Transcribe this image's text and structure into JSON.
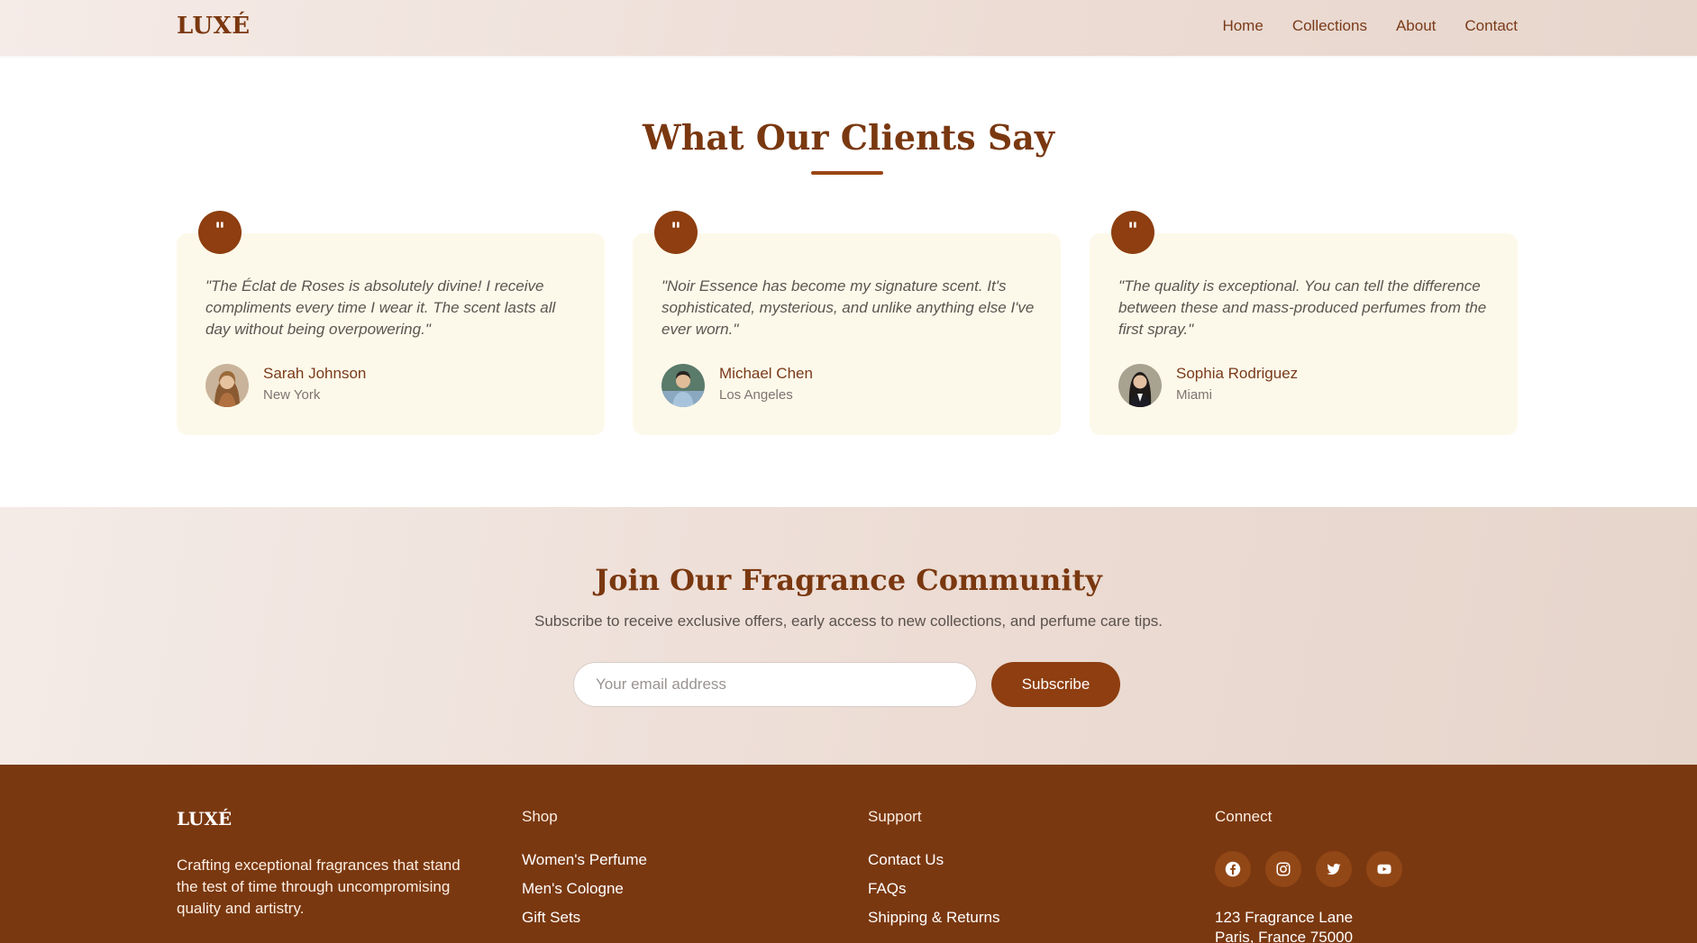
{
  "header": {
    "logo": "LUXÉ",
    "nav": [
      "Home",
      "Collections",
      "About",
      "Contact"
    ]
  },
  "testimonials": {
    "title": "What Our Clients Say",
    "quote_mark": "\"",
    "items": [
      {
        "text": "\"The Éclat de Roses is absolutely divine! I receive compliments every time I wear it. The scent lasts all day without being overpowering.\"",
        "name": "Sarah Johnson",
        "location": "New York"
      },
      {
        "text": "\"Noir Essence has become my signature scent. It's sophisticated, mysterious, and unlike anything else I've ever worn.\"",
        "name": "Michael Chen",
        "location": "Los Angeles"
      },
      {
        "text": "\"The quality is exceptional. You can tell the difference between these and mass-produced perfumes from the first spray.\"",
        "name": "Sophia Rodriguez",
        "location": "Miami"
      }
    ]
  },
  "newsletter": {
    "title": "Join Our Fragrance Community",
    "subtitle": "Subscribe to receive exclusive offers, early access to new collections, and perfume care tips.",
    "email_placeholder": "Your email address",
    "subscribe_label": "Subscribe"
  },
  "footer": {
    "logo": "LUXÉ",
    "about": "Crafting exceptional fragrances that stand the test of time through uncompromising quality and artistry.",
    "shop": {
      "heading": "Shop",
      "links": [
        "Women's Perfume",
        "Men's Cologne",
        "Gift Sets"
      ]
    },
    "support": {
      "heading": "Support",
      "links": [
        "Contact Us",
        "FAQs",
        "Shipping & Returns"
      ]
    },
    "connect": {
      "heading": "Connect",
      "socials": [
        "facebook-icon",
        "instagram-icon",
        "twitter-icon",
        "youtube-icon"
      ],
      "address_line1": "123 Fragrance Lane",
      "address_line2": "Paris, France 75000"
    }
  },
  "colors": {
    "brand": "#7a3810",
    "accent": "#8e3e10",
    "card_bg": "#fdf9ea"
  }
}
